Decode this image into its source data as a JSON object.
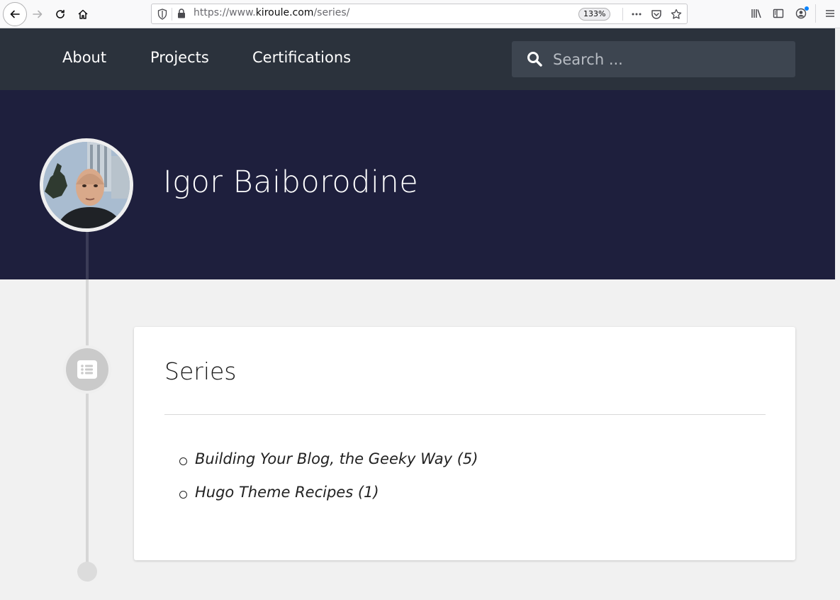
{
  "browser": {
    "url_prefix": "https://www.",
    "url_domain": "kiroule.com",
    "url_path": "/series/",
    "zoom": "133%"
  },
  "nav": {
    "items": [
      {
        "label": "About"
      },
      {
        "label": "Projects"
      },
      {
        "label": "Certifications"
      }
    ],
    "search_placeholder": "Search ..."
  },
  "hero": {
    "name": "Igor Baiborodine"
  },
  "main": {
    "title": "Series",
    "series": [
      {
        "label": "Building Your Blog, the Geeky Way (5)"
      },
      {
        "label": "Hugo Theme Recipes (1)"
      }
    ]
  },
  "colors": {
    "nav_bg": "#2b323c",
    "hero_bg": "#1e1f3d",
    "page_bg": "#f1f1f1"
  }
}
